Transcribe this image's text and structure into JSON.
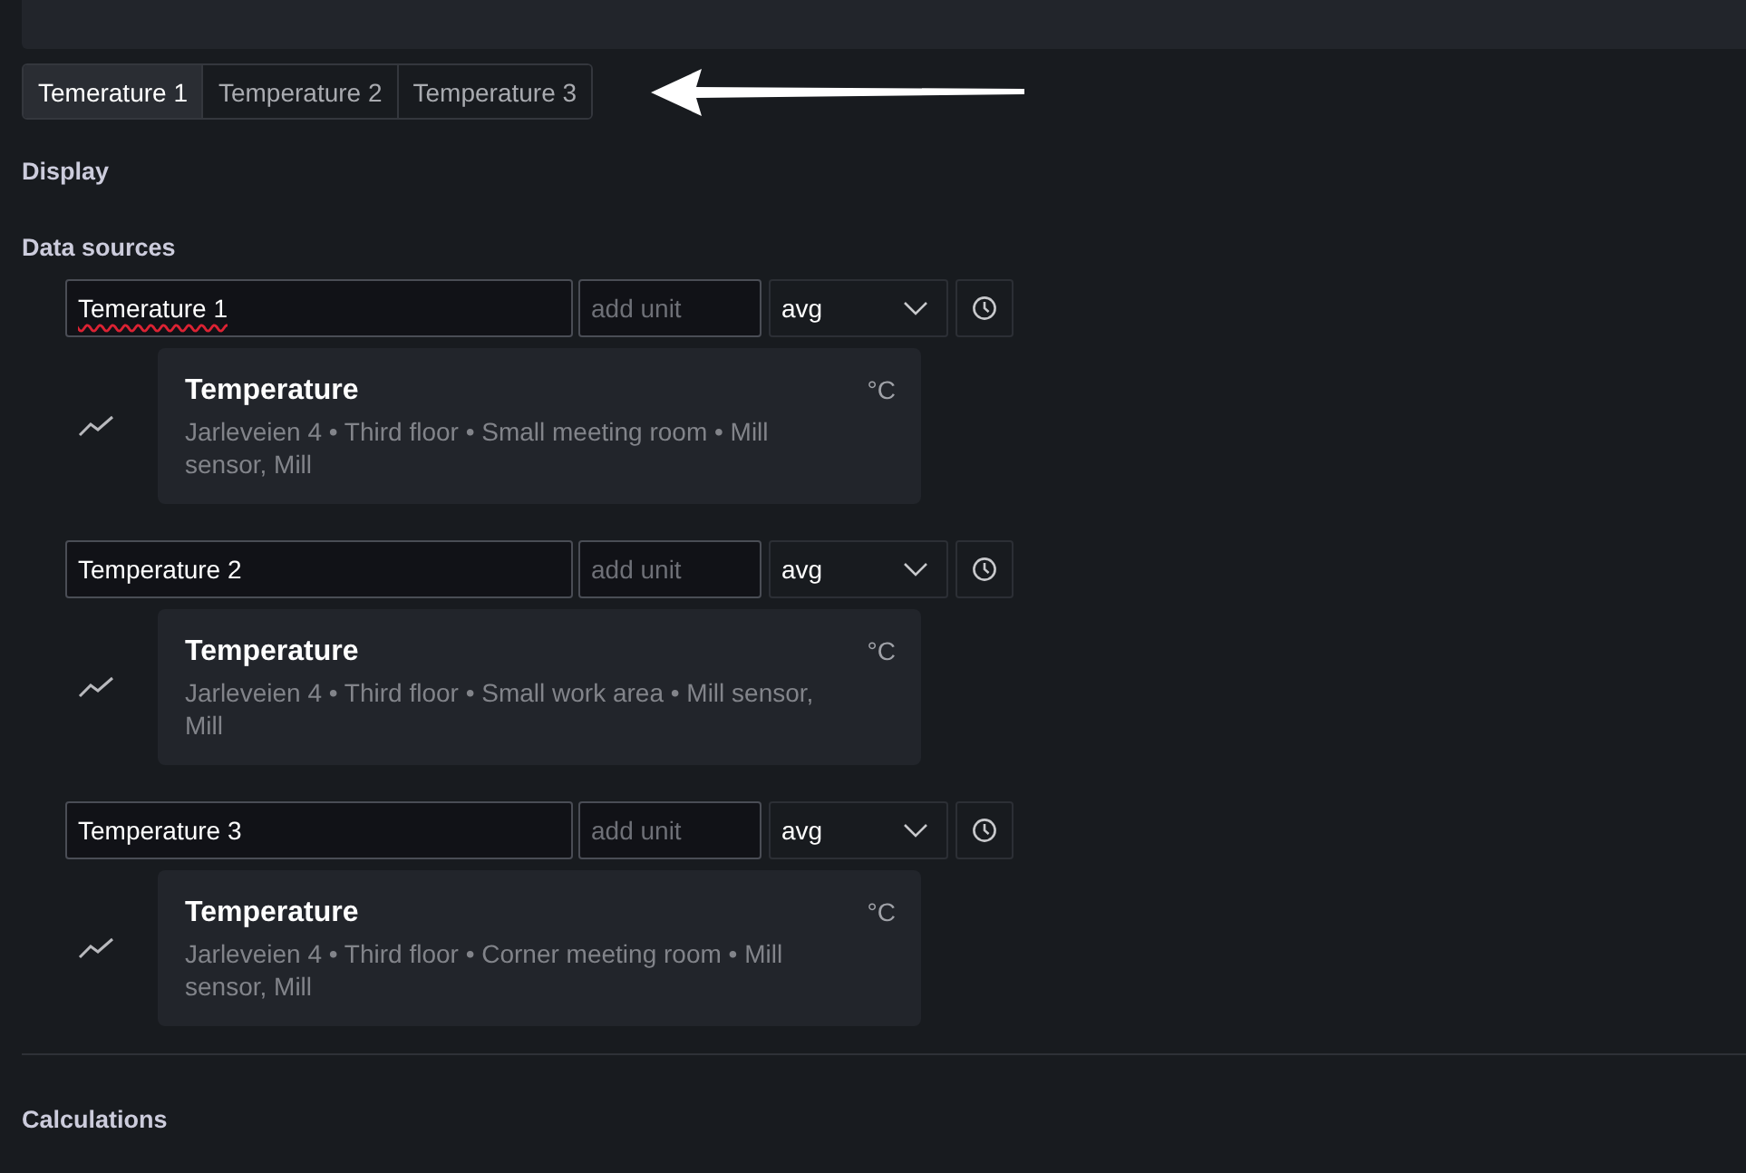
{
  "tabs": [
    {
      "label": "Temerature 1",
      "selected": true
    },
    {
      "label": "Temperature 2",
      "selected": false
    },
    {
      "label": "Temperature 3",
      "selected": false
    }
  ],
  "annotation": {
    "kind": "arrow"
  },
  "display_heading": "Display",
  "data_sources_heading": "Data sources",
  "sources": [
    {
      "name": "Temerature 1",
      "misspelled": true,
      "unit_placeholder": "add unit",
      "aggregation": "avg",
      "metric": "Temperature",
      "unit": "°C",
      "path": "Jarleveien 4 • Third floor • Small meeting room • Mill sensor, Mill"
    },
    {
      "name": "Temperature 2",
      "misspelled": false,
      "unit_placeholder": "add unit",
      "aggregation": "avg",
      "metric": "Temperature",
      "unit": "°C",
      "path": "Jarleveien 4 • Third floor • Small work area • Mill sensor, Mill"
    },
    {
      "name": "Temperature 3",
      "misspelled": false,
      "unit_placeholder": "add unit",
      "aggregation": "avg",
      "metric": "Temperature",
      "unit": "°C",
      "path": "Jarleveien 4 • Third floor • Corner meeting room • Mill sensor, Mill"
    }
  ],
  "calculations_heading": "Calculations"
}
